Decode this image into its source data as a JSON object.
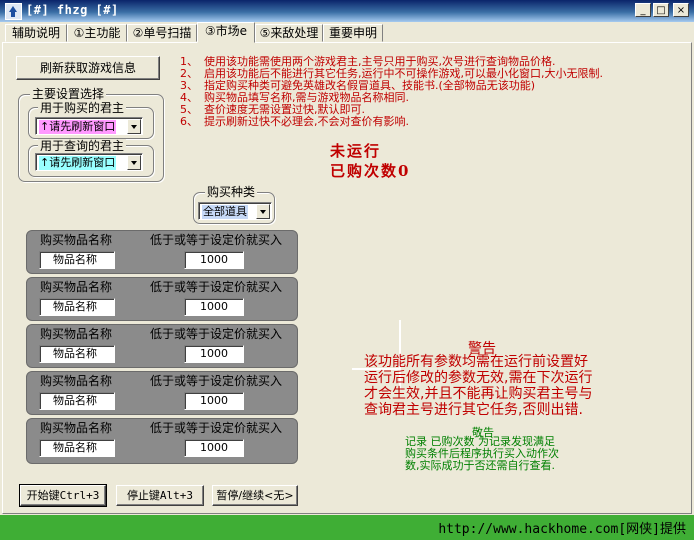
{
  "window": {
    "title": "[#] fhzg [#]",
    "minimize": "_",
    "maximize": "□",
    "close": "×"
  },
  "tabs": [
    {
      "label": "辅助说明"
    },
    {
      "label": "①主功能"
    },
    {
      "label": "②单号扫描"
    },
    {
      "label": "③市场e"
    },
    {
      "label": "⑤来敌处理"
    },
    {
      "label": "重要申明"
    }
  ],
  "refresh_button": "刷新获取游戏信息",
  "main_settings": {
    "title": "主要设置选择",
    "buy_title": "用于购买的君主",
    "buy_value": "↑请先刷新窗口",
    "query_title": "用于查询的君主",
    "query_value": "↑请先刷新窗口"
  },
  "instructions": [
    {
      "num": "1、",
      "text": "使用该功能需使用两个游戏君主,主号只用于购买,次号进行查询物品价格."
    },
    {
      "num": "2、",
      "text": "启用该功能后不能进行其它任务,运行中不可操作游戏,可以最小化窗口,大小无限制."
    },
    {
      "num": "3、",
      "text": "指定购买种类可避免英雄改名假冒道具、技能书.(全部物品无该功能)"
    },
    {
      "num": "4、",
      "text": "购买物品填写名称,需与游戏物品名称相同."
    },
    {
      "num": "5、",
      "text": "查价速度无需设置过快,默认即可."
    },
    {
      "num": "6、",
      "text": "提示刷新过快不必理会,不会对查价有影响."
    }
  ],
  "status": {
    "running": "未运行",
    "bought": "已购次数0"
  },
  "buy_type": {
    "title": "购买种类",
    "value": "全部道具"
  },
  "items": [
    {
      "name_label": "购买物品名称",
      "price_label": "低于或等于设定价就买入",
      "name_value": "物品名称",
      "price_value": "1000"
    },
    {
      "name_label": "购买物品名称",
      "price_label": "低于或等于设定价就买入",
      "name_value": "物品名称",
      "price_value": "1000"
    },
    {
      "name_label": "购买物品名称",
      "price_label": "低于或等于设定价就买入",
      "name_value": "物品名称",
      "price_value": "1000"
    },
    {
      "name_label": "购买物品名称",
      "price_label": "低于或等于设定价就买入",
      "name_value": "物品名称",
      "price_value": "1000"
    },
    {
      "name_label": "购买物品名称",
      "price_label": "低于或等于设定价就买入",
      "name_value": "物品名称",
      "price_value": "1000"
    }
  ],
  "warning": {
    "title": "警告",
    "lines": [
      "该功能所有参数均需在运行前设置好",
      "运行后修改的参数无效,需在下次运行",
      "才会生效,并且不能再让购买君主号与",
      "查询君主号进行其它任务,否则出错."
    ]
  },
  "notice": {
    "title": "敬告",
    "lines": [
      "记录 已购次数 为记录发现满足",
      "购买条件后程序执行买入动作次",
      "数,实际成功于否还需自行查看."
    ]
  },
  "controls": {
    "start": "开始键Ctrl+3",
    "stop": "停止键Alt+3",
    "pause": "暂停/继续<无>"
  },
  "watermark": "http://www.hackhome.com[网侠]提供"
}
